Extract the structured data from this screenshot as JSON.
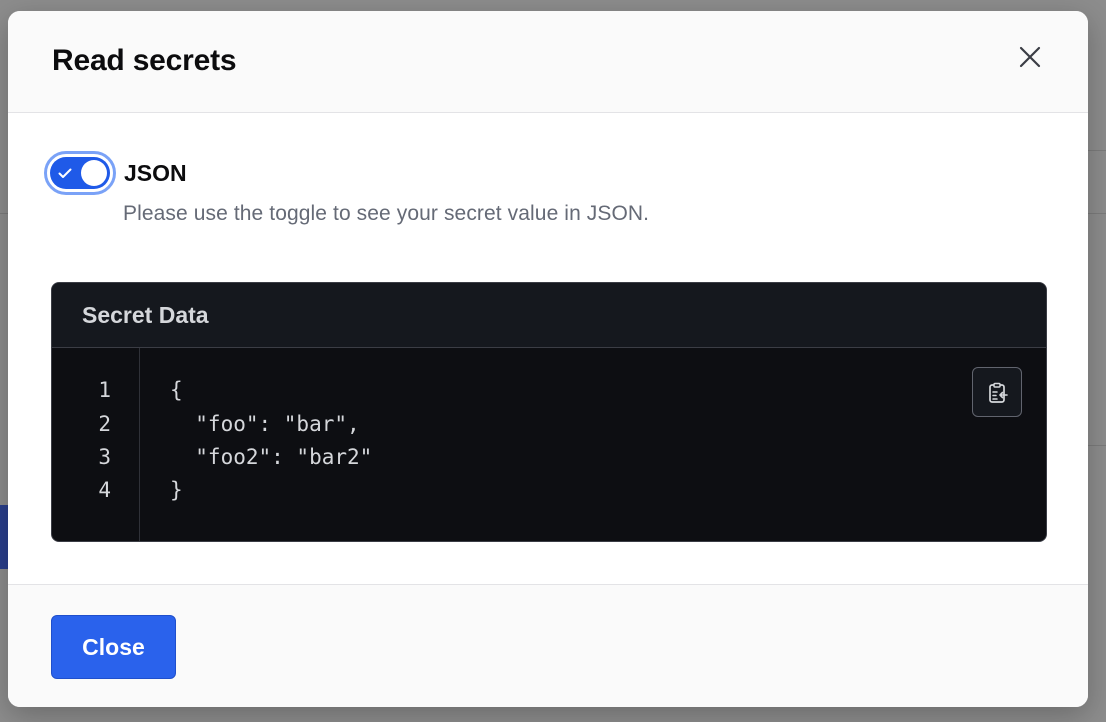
{
  "modal": {
    "title": "Read secrets",
    "close_icon": "close-icon"
  },
  "toggle": {
    "label": "JSON",
    "checked": true,
    "help_text": "Please use the toggle to see your secret value in JSON.",
    "check_icon": "checkmark-icon"
  },
  "code_block": {
    "title": "Secret Data",
    "copy_icon": "clipboard-copy-icon",
    "lines": [
      {
        "num": "1",
        "text": "{"
      },
      {
        "num": "2",
        "text": "  \"foo\": \"bar\","
      },
      {
        "num": "3",
        "text": "  \"foo2\": \"bar2\""
      },
      {
        "num": "4",
        "text": "}"
      }
    ]
  },
  "footer": {
    "close_label": "Close"
  },
  "colors": {
    "primary": "#2a62ec",
    "toggle_on": "#1f5ae8",
    "code_bg": "#0d0e12"
  }
}
